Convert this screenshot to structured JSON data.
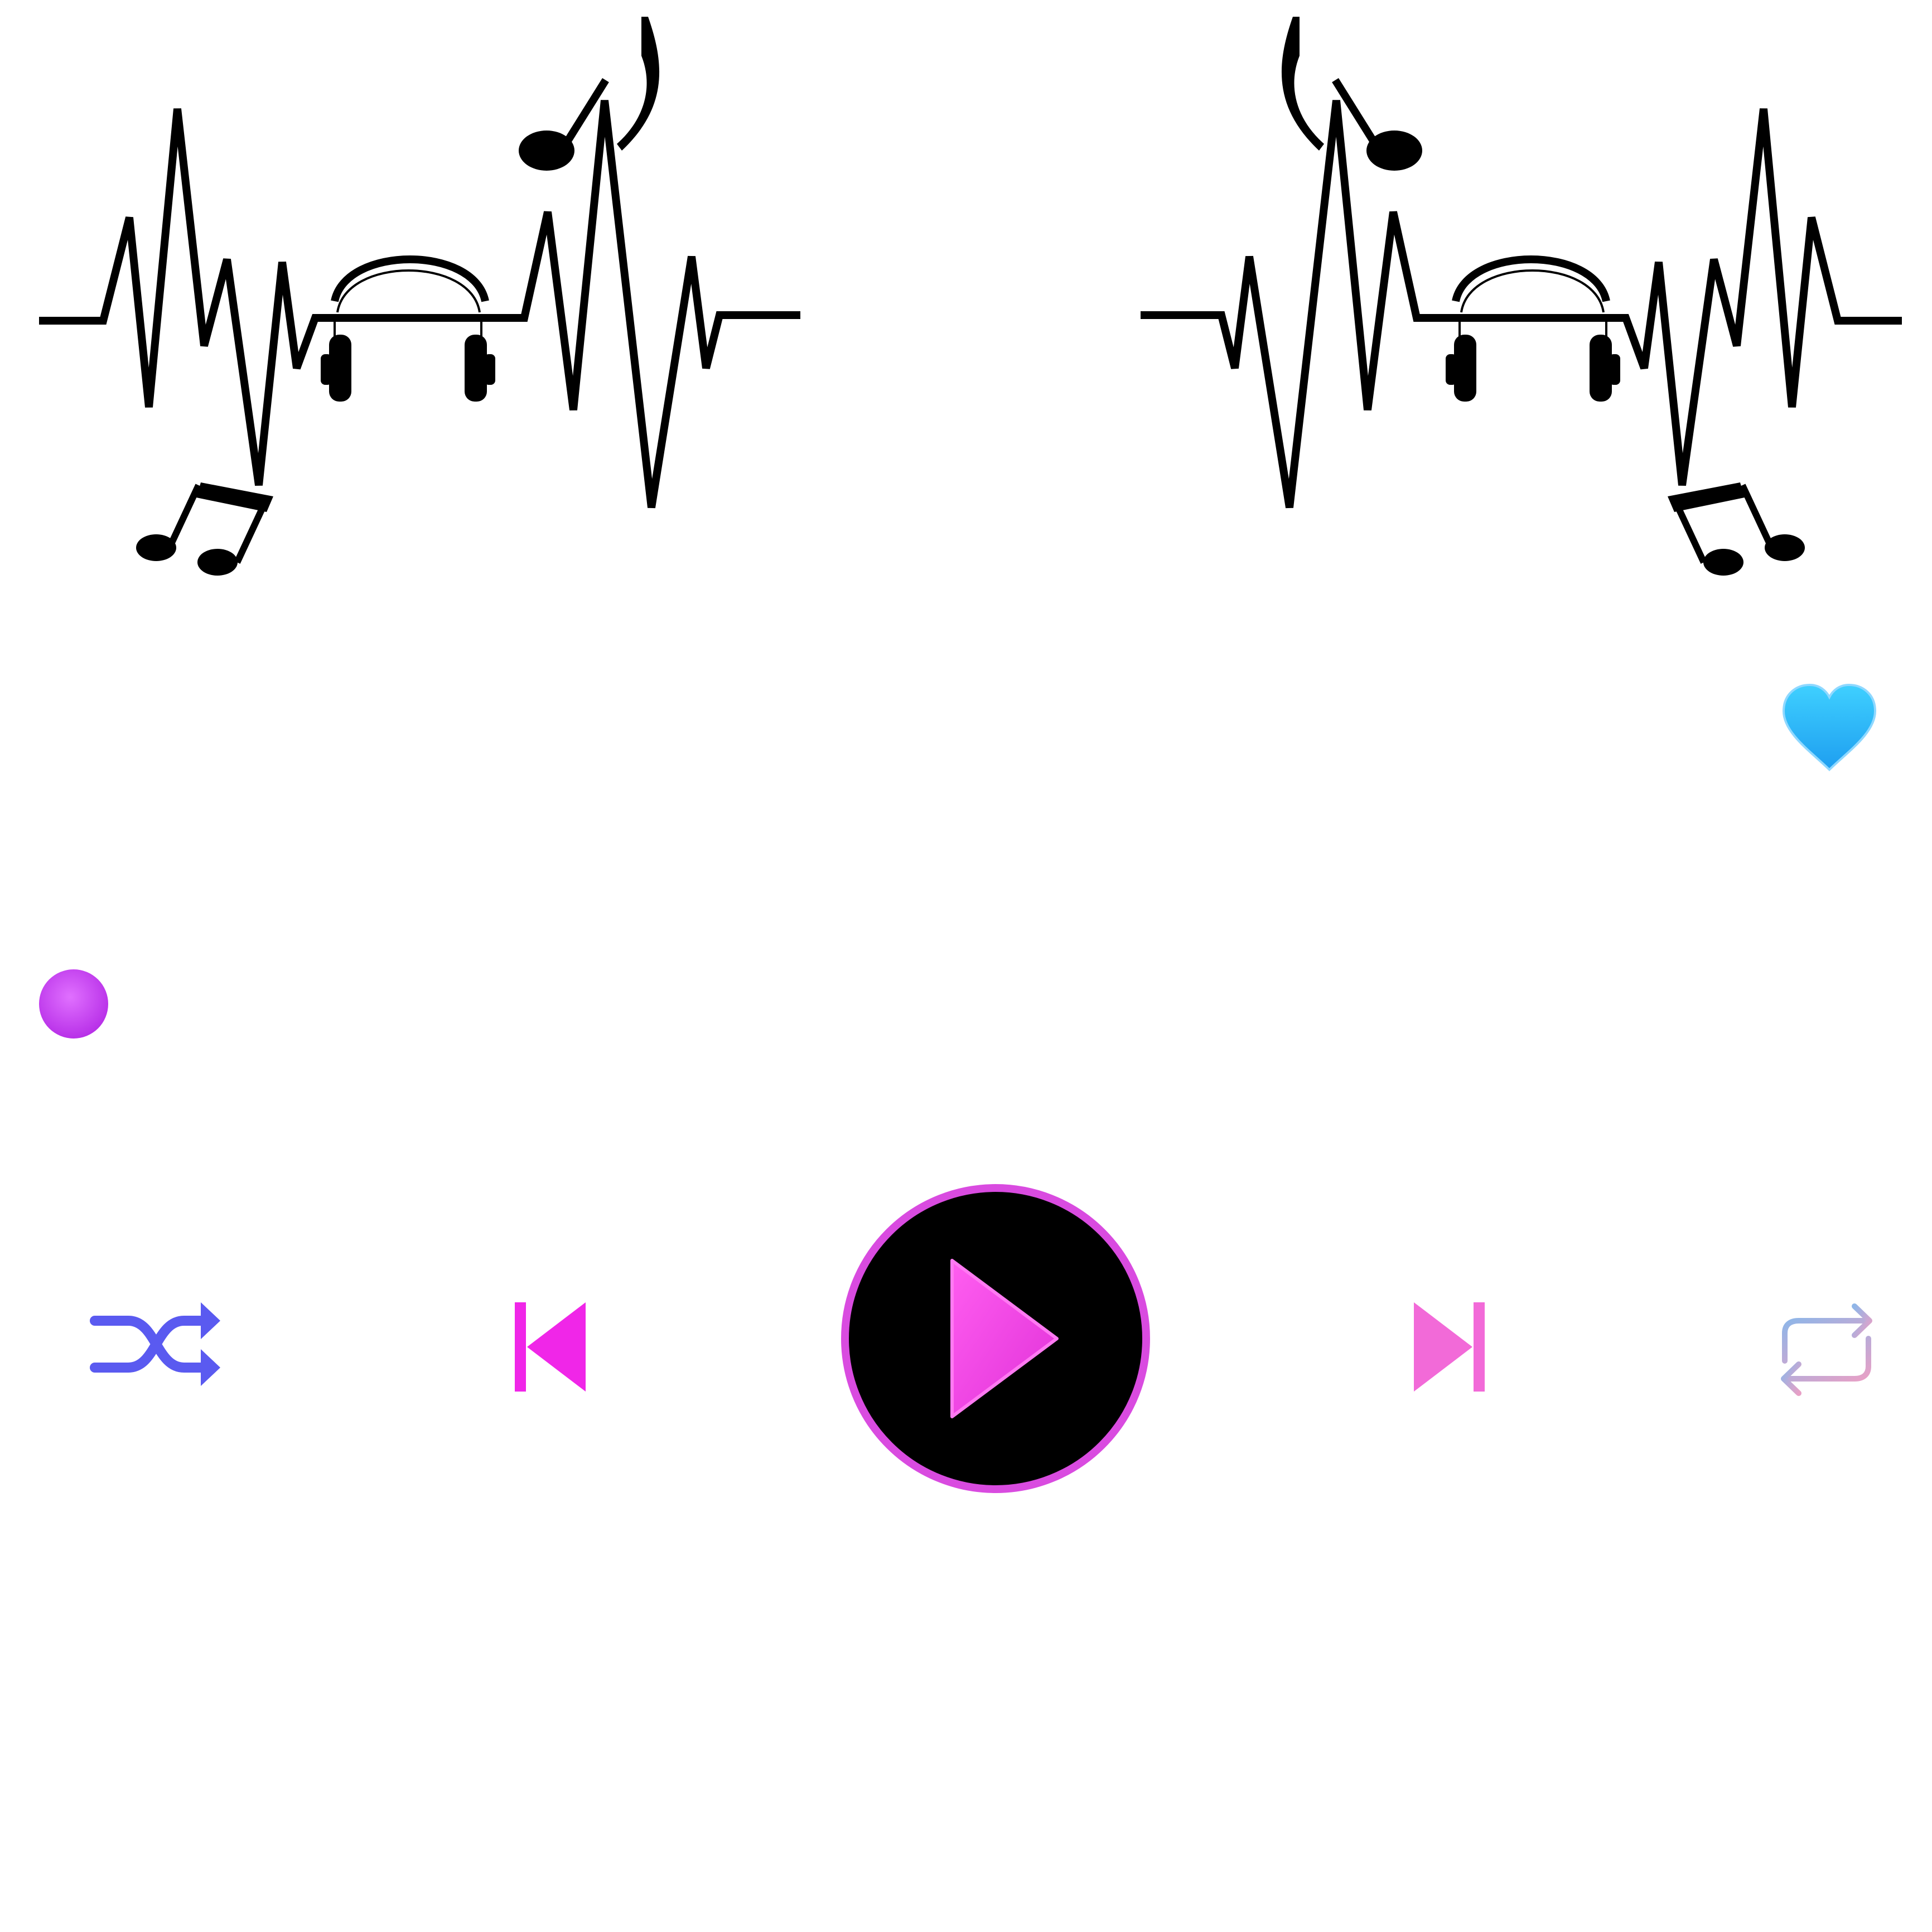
{
  "player": {
    "progress": 0,
    "liked": true,
    "is_playing": false
  },
  "icons": {
    "left_art": "heartbeat-music-icon",
    "right_art": "heartbeat-music-icon",
    "like": "heart-icon",
    "shuffle": "shuffle-icon",
    "previous": "skip-previous-icon",
    "play": "play-icon",
    "next": "skip-next-icon",
    "repeat": "repeat-icon"
  },
  "colors": {
    "background": "#ffffff",
    "art": "#000000",
    "heart": "#29b6f6",
    "seek_start": "#c83cf2",
    "seek_end": "#1ec8a5",
    "thumb": "#c440ee",
    "shuffle": "#5a5af0",
    "previous": "#f026e8",
    "play_ring": "#d94be0",
    "play_triangle": "#f34fe6",
    "next": "#f26ad8",
    "repeat_start": "#8fb6e8",
    "repeat_end": "#e8a0c6"
  }
}
